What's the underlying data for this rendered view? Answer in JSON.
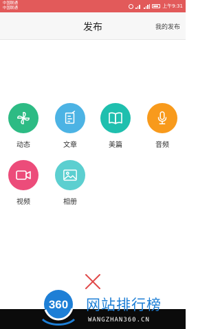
{
  "status_bar": {
    "carrier1": "中国联通",
    "carrier2": "中国联通",
    "time": "上午9:31"
  },
  "header": {
    "title": "发布",
    "my_publish": "我的发布"
  },
  "items": [
    {
      "label": "动态",
      "icon": "pinwheel-icon",
      "color": "#2dbb84"
    },
    {
      "label": "文章",
      "icon": "edit-note-icon",
      "color": "#4cb3e4"
    },
    {
      "label": "美篇",
      "icon": "book-icon",
      "color": "#1fbfae"
    },
    {
      "label": "音频",
      "icon": "microphone-icon",
      "color": "#f89a1c"
    },
    {
      "label": "视频",
      "icon": "video-camera-icon",
      "color": "#ec4c7a"
    },
    {
      "label": "相册",
      "icon": "photo-icon",
      "color": "#5ccfd0"
    }
  ],
  "close_icon": "close-icon",
  "watermark": {
    "logo": "360",
    "title": "网站排行榜",
    "url": "WANGZHAN360.CN"
  }
}
